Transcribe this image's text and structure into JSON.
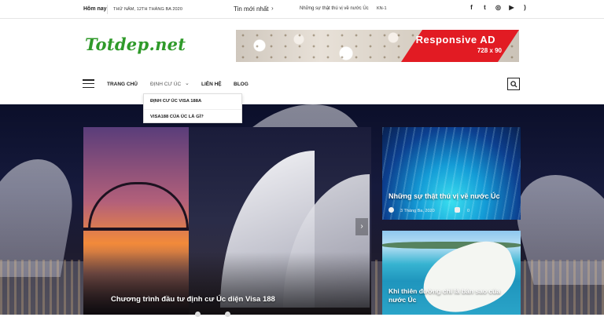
{
  "topbar": {
    "today_label": "Hôm nay",
    "date": "THỨ NĂM, 12TH THÁNG BA 2020",
    "news_label": "Tin mới nhất",
    "news_arrow": "›",
    "news_item": "Những sự thật thú vị về nước Úc",
    "news_author": "KN-1",
    "social": [
      {
        "icon": "facebook-icon",
        "glyph": "f"
      },
      {
        "icon": "twitter-icon",
        "glyph": "t"
      },
      {
        "icon": "instagram-icon",
        "glyph": "◎"
      },
      {
        "icon": "youtube-icon",
        "glyph": "▶"
      },
      {
        "icon": "rss-icon",
        "glyph": ")"
      }
    ]
  },
  "logo": "Totdep.net",
  "banner": {
    "title": "Responsive AD",
    "size": "728 x 90"
  },
  "nav": {
    "items": [
      {
        "label": "TRANG CHỦ"
      },
      {
        "label": "ĐỊNH CƯ ÚC",
        "dropdown_icon": "chevron-down-icon"
      },
      {
        "label": "LIÊN HỆ"
      },
      {
        "label": "BLOG"
      }
    ],
    "dropdown": [
      {
        "label": "ĐỊNH CƯ ÚC VISA 188A"
      },
      {
        "label": "VISA188 CỦA ÚC LÀ GÌ?"
      }
    ],
    "search_icon": "search-icon",
    "menu_icon": "hamburger-menu-icon"
  },
  "hero": {
    "main": {
      "title": "Chương trình đầu tư định cư Úc diện Visa 188"
    },
    "card1": {
      "title": "Những sự thật thú vị về nước Úc",
      "date": "3 Tháng Ba, 2020",
      "comments": "0"
    },
    "card2": {
      "title": "Khi thiên đường chỉ là bản sao của nước Úc"
    },
    "next_icon": "chevron-right-icon"
  },
  "colors": {
    "logo": "#2f9a2a",
    "banner_accent": "#e21b23"
  }
}
